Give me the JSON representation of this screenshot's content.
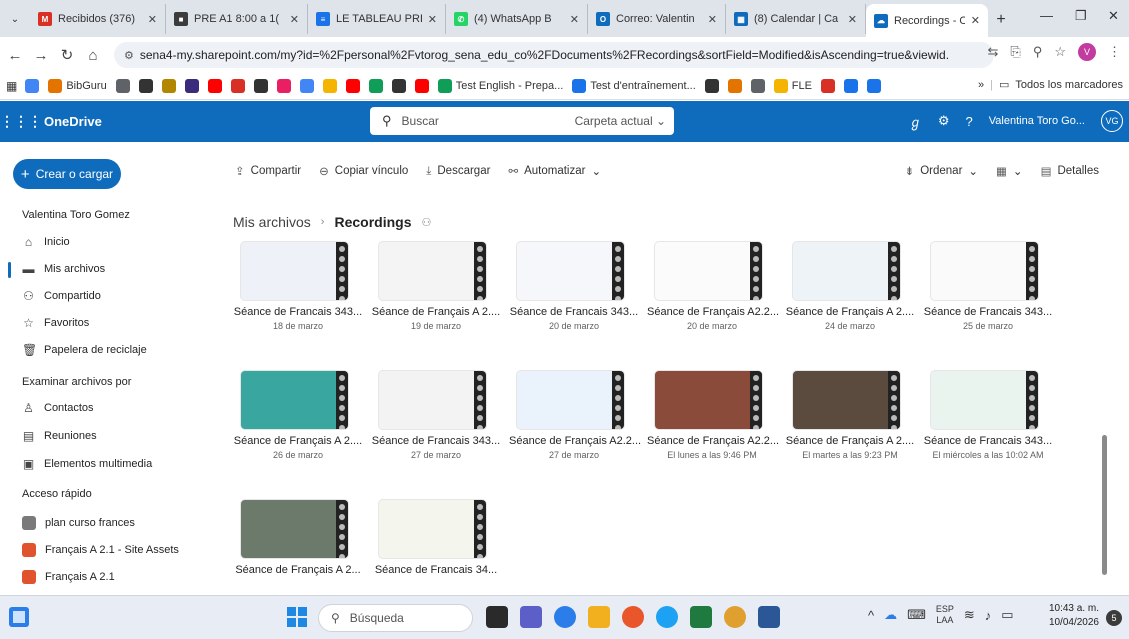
{
  "browser": {
    "tabs": [
      {
        "title": "Recibidos (376)",
        "color": "#d93025",
        "glyph": "M"
      },
      {
        "title": "PRE A1 8:00 a 1(",
        "color": "#3c3c3c",
        "glyph": "■"
      },
      {
        "title": "LE TABLEAU PRE",
        "color": "#1a73e8",
        "glyph": "≡"
      },
      {
        "title": "(4) WhatsApp B",
        "color": "#25d366",
        "glyph": "✆"
      },
      {
        "title": "Correo: Valentin",
        "color": "#0f6cbd",
        "glyph": "O"
      },
      {
        "title": "(8) Calendar | Ca",
        "color": "#0f6cbd",
        "glyph": "▦"
      },
      {
        "title": "Recordings - On",
        "color": "#0f6cbd",
        "glyph": "☁"
      }
    ],
    "url": "sena4-my.sharepoint.com/my?id=%2Fpersonal%2Fvtorog_sena_edu_co%2FDocuments%2FRecordings&sortField=Modified&isAscending=true&viewid...",
    "profile_initial": "V",
    "bookmarks": {
      "items": [
        {
          "label": "",
          "color": "#4285f4"
        },
        {
          "label": "BibGuru",
          "color": "#e37400"
        },
        {
          "label": "",
          "color": "#5f6368"
        },
        {
          "label": "",
          "color": "#333"
        },
        {
          "label": "",
          "color": "#b38600"
        },
        {
          "label": "",
          "color": "#3c2a7a"
        },
        {
          "label": "",
          "color": "#ff0000"
        },
        {
          "label": "",
          "color": "#d93025"
        },
        {
          "label": "",
          "color": "#333"
        },
        {
          "label": "",
          "color": "#e91e63"
        },
        {
          "label": "",
          "color": "#4285f4"
        },
        {
          "label": "",
          "color": "#f4b400"
        },
        {
          "label": "",
          "color": "#ff0000"
        },
        {
          "label": "",
          "color": "#0f9d58"
        },
        {
          "label": "",
          "color": "#333"
        },
        {
          "label": "",
          "color": "#ff0000"
        },
        {
          "label": "Test English - Prepa...",
          "color": "#0f9d58"
        },
        {
          "label": "Test d'entraînement...",
          "color": "#1a73e8"
        },
        {
          "label": "",
          "color": "#333"
        },
        {
          "label": "",
          "color": "#e37400"
        },
        {
          "label": "",
          "color": "#5f6368"
        },
        {
          "label": "FLE",
          "color": "#f4b400"
        },
        {
          "label": "",
          "color": "#d93025"
        },
        {
          "label": "",
          "color": "#1a73e8"
        },
        {
          "label": "",
          "color": "#1a73e8"
        }
      ],
      "overflow": "»",
      "all_bookmarks": "Todos los marcadores"
    }
  },
  "onedrive": {
    "brand": "OneDrive",
    "search_placeholder": "Buscar",
    "search_scope": "Carpeta actual",
    "user_name": "Valentina Toro Go...",
    "user_initials": "VG"
  },
  "sidebar": {
    "create_label": "Crear o cargar",
    "user_heading": "Valentina Toro Gomez",
    "nav": [
      {
        "label": "Inicio",
        "icon": "⌂"
      },
      {
        "label": "Mis archivos",
        "icon": "▬"
      },
      {
        "label": "Compartido",
        "icon": "⚇"
      },
      {
        "label": "Favoritos",
        "icon": "☆"
      },
      {
        "label": "Papelera de reciclaje",
        "icon": "🗑"
      }
    ],
    "browse_heading": "Examinar archivos por",
    "browse": [
      {
        "label": "Contactos",
        "icon": "♙"
      },
      {
        "label": "Reuniones",
        "icon": "▤"
      },
      {
        "label": "Elementos multimedia",
        "icon": "▣"
      }
    ],
    "quick_heading": "Acceso rápido",
    "quick": [
      {
        "label": "plan curso frances",
        "color": "#7a7a7a"
      },
      {
        "label": "Français A 2.1 - Site Assets",
        "color": "#e0532f"
      },
      {
        "label": "Français A 2.1",
        "color": "#e0532f"
      }
    ]
  },
  "commands": {
    "share": "Compartir",
    "copy_link": "Copiar vínculo",
    "download": "Descargar",
    "automate": "Automatizar",
    "sort": "Ordenar",
    "details": "Detalles"
  },
  "breadcrumb": {
    "root": "Mis archivos",
    "current": "Recordings"
  },
  "files": [
    {
      "title": "Séance de Francais 343...",
      "date": "18 de marzo",
      "bg": "#eef2f8"
    },
    {
      "title": "Séance de Français A 2....",
      "date": "19 de marzo",
      "bg": "#f4f4f4"
    },
    {
      "title": "Séance de Francais 343...",
      "date": "20 de marzo",
      "bg": "#f5f7fb"
    },
    {
      "title": "Séance de Français A2.2...",
      "date": "20 de marzo",
      "bg": "#fbfbfb"
    },
    {
      "title": "Séance de Français A 2....",
      "date": "24 de marzo",
      "bg": "#eef3f8"
    },
    {
      "title": "Séance de Francais 343...",
      "date": "25 de marzo",
      "bg": "#fafafa"
    },
    {
      "title": "Séance de Français A 2....",
      "date": "26 de marzo",
      "bg": "#3aa6a0"
    },
    {
      "title": "Séance de Francais 343...",
      "date": "27 de marzo",
      "bg": "#f3f3f3"
    },
    {
      "title": "Séance de Français A2.2...",
      "date": "27 de marzo",
      "bg": "#eaf2fb"
    },
    {
      "title": "Séance de Français A2.2...",
      "date": "El lunes a las 9:46 PM",
      "bg": "#8a4b3a"
    },
    {
      "title": "Séance de Français A 2....",
      "date": "El martes a las 9:23 PM",
      "bg": "#5b4a3e"
    },
    {
      "title": "Séance de Francais 343...",
      "date": "El miércoles a las 10:02 AM",
      "bg": "#eaf4ef"
    },
    {
      "title": "Séance de Français A 2...",
      "date": "",
      "bg": "#6b7a6a"
    },
    {
      "title": "Séance de Francais 34...",
      "date": "",
      "bg": "#f4f6ee"
    }
  ],
  "taskbar": {
    "search_placeholder": "Búsqueda",
    "lang_top": "ESP",
    "lang_bottom": "LAA",
    "time": "10:43 a. m.",
    "date": "10/04/2026",
    "notifications": "5"
  }
}
